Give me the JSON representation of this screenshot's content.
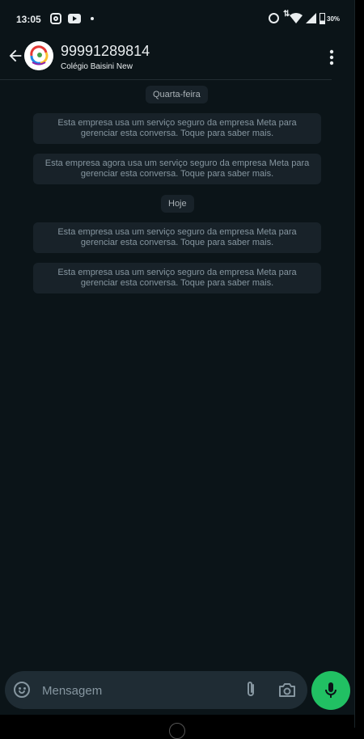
{
  "status_bar": {
    "time": "13:05",
    "battery": "30%"
  },
  "header": {
    "title": "99991289814",
    "subtitle": "Colégio Baisini New"
  },
  "chat": {
    "date_chips": [
      "Quarta-feira",
      "Hoje"
    ],
    "messages": [
      "Esta empresa usa um serviço seguro da empresa Meta para gerenciar esta conversa. Toque para saber mais.",
      "Esta empresa agora usa um serviço seguro da empresa Meta para gerenciar esta conversa. Toque para saber mais.",
      "Esta empresa usa um serviço seguro da empresa Meta para gerenciar esta conversa. Toque para saber mais.",
      "Esta empresa usa um serviço seguro da empresa Meta para gerenciar esta conversa. Toque para saber mais."
    ]
  },
  "composer": {
    "placeholder": "Mensagem"
  },
  "colors": {
    "background": "#0b1418",
    "bubble": "#182229",
    "accent": "#21c063"
  },
  "icons": [
    "instagram-icon",
    "youtube-icon",
    "alarm-icon",
    "wifi-icon",
    "signal-icon",
    "battery-icon",
    "back-arrow-icon",
    "more-vert-icon",
    "emoji-icon",
    "attach-icon",
    "camera-icon",
    "mic-icon"
  ]
}
